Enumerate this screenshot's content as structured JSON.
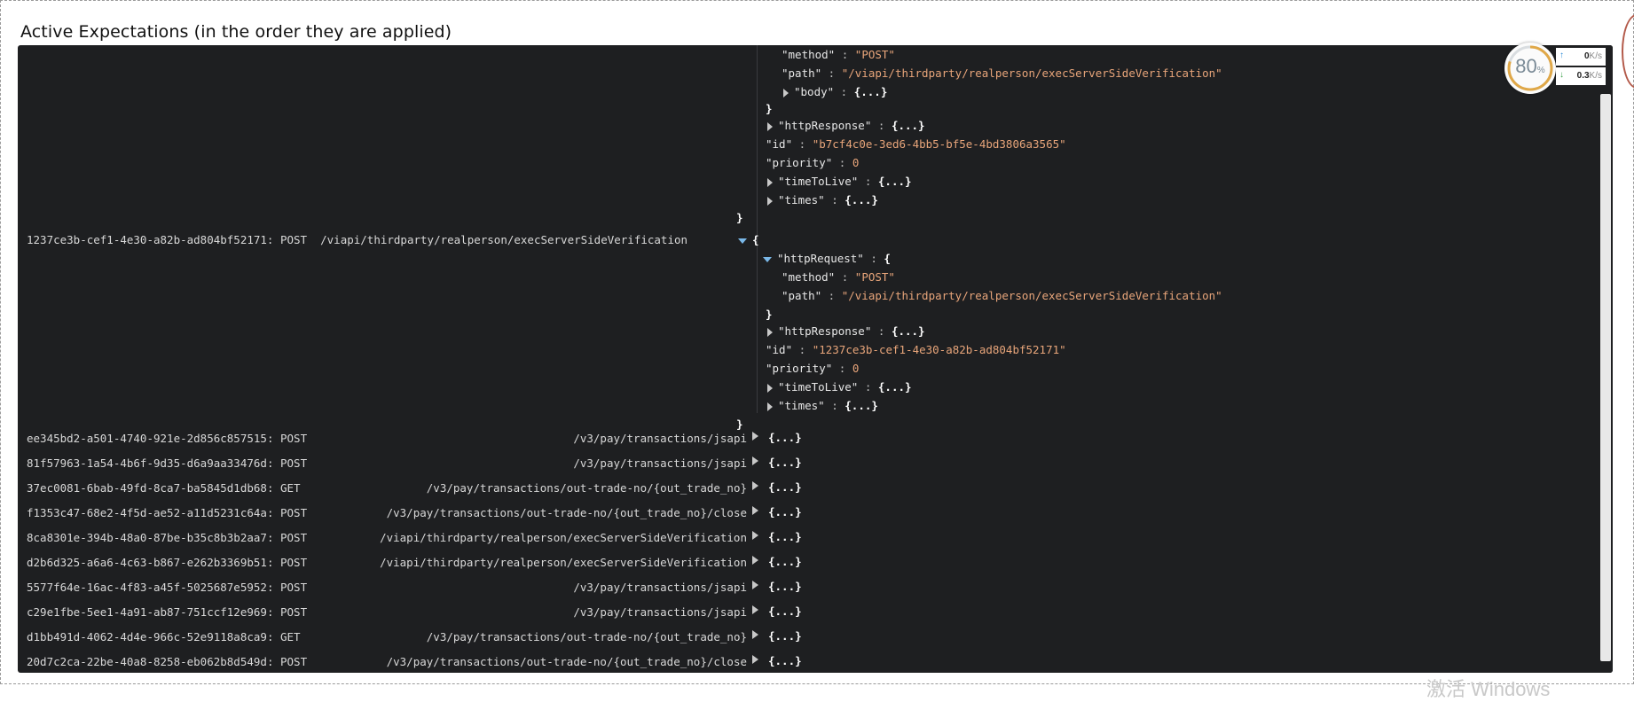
{
  "section": {
    "title": "Active Expectations (in the order they are applied)"
  },
  "top_fragment": {
    "method_key": "\"method\"",
    "method_val": "\"POST\"",
    "path_key": "\"path\"",
    "path_val": "\"/viapi/thirdparty/realperson/execServerSideVerification\"",
    "body_key": "\"body\"",
    "httpResponse_key": "\"httpResponse\"",
    "id_key": "\"id\"",
    "id_val": "\"b7cf4c0e-3ed6-4bb5-bf5e-4bd3806a3565\"",
    "priority_key": "\"priority\"",
    "priority_val": "0",
    "timeToLive_key": "\"timeToLive\"",
    "times_key": "\"times\""
  },
  "expanded": {
    "label": "1237ce3b-cef1-4e30-a82b-ad804bf52171: POST  /viapi/thirdparty/realperson/execServerSideVerification",
    "httpRequest_key": "\"httpRequest\"",
    "method_key": "\"method\"",
    "method_val": "\"POST\"",
    "path_key": "\"path\"",
    "path_val": "\"/viapi/thirdparty/realperson/execServerSideVerification\"",
    "httpResponse_key": "\"httpResponse\"",
    "id_key": "\"id\"",
    "id_val": "\"1237ce3b-cef1-4e30-a82b-ad804bf52171\"",
    "priority_key": "\"priority\"",
    "priority_val": "0",
    "timeToLive_key": "\"timeToLive\"",
    "times_key": "\"times\""
  },
  "json": {
    "colon": " : ",
    "open": "{",
    "close": "}",
    "collapsed": "{...}"
  },
  "expectations": [
    {
      "id": "ee345bd2-a501-4740-921e-2d856c857515",
      "method": "POST",
      "path": "/v3/pay/transactions/jsapi"
    },
    {
      "id": "81f57963-1a54-4b6f-9d35-d6a9aa33476d",
      "method": "POST",
      "path": "/v3/pay/transactions/jsapi"
    },
    {
      "id": "37ec0081-6bab-49fd-8ca7-ba5845d1db68",
      "method": "GET",
      "path": "/v3/pay/transactions/out-trade-no/{out_trade_no}"
    },
    {
      "id": "f1353c47-68e2-4f5d-ae52-a11d5231c64a",
      "method": "POST",
      "path": "/v3/pay/transactions/out-trade-no/{out_trade_no}/close"
    },
    {
      "id": "8ca8301e-394b-48a0-87be-b35c8b3b2aa7",
      "method": "POST",
      "path": "/viapi/thirdparty/realperson/execServerSideVerification"
    },
    {
      "id": "d2b6d325-a6a6-4c63-b867-e262b3369b51",
      "method": "POST",
      "path": "/viapi/thirdparty/realperson/execServerSideVerification"
    },
    {
      "id": "5577f64e-16ac-4f83-a45f-5025687e5952",
      "method": "POST",
      "path": "/v3/pay/transactions/jsapi"
    },
    {
      "id": "c29e1fbe-5ee1-4a91-ab87-751ccf12e969",
      "method": "POST",
      "path": "/v3/pay/transactions/jsapi"
    },
    {
      "id": "d1bb491d-4062-4d4e-966c-52e9118a8ca9",
      "method": "GET",
      "path": "/v3/pay/transactions/out-trade-no/{out_trade_no}"
    },
    {
      "id": "20d7c2ca-22be-40a8-8258-eb062b8d549d",
      "method": "POST",
      "path": "/v3/pay/transactions/out-trade-no/{out_trade_no}/close"
    }
  ],
  "widget": {
    "percent": "80",
    "percent_unit": "%",
    "up_value": "0",
    "down_value": "0.3",
    "rate_unit": "K/s",
    "up_arrow": "↑",
    "down_arrow": "↓"
  },
  "watermark": "激活 Windows"
}
